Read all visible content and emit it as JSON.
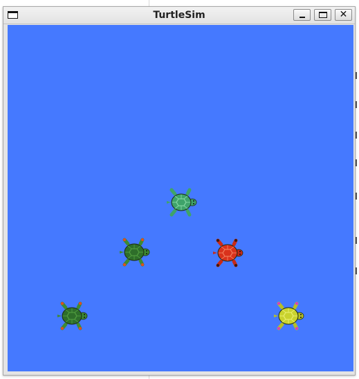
{
  "window": {
    "title": "TurtleSim"
  },
  "canvas": {
    "background_color": "#4579ff"
  },
  "turtles": [
    {
      "name": "turtle-top-center",
      "shell": "#3fa36a",
      "shell_pattern": "#7fd3a0",
      "limbs": "#3fa36a",
      "accent": "#3fa36a"
    },
    {
      "name": "turtle-middle-left",
      "shell": "#2e6e2a",
      "shell_pattern": "#4f9b3f",
      "limbs": "#3d8a34",
      "accent": "#e44b1f"
    },
    {
      "name": "turtle-middle-right",
      "shell": "#d9321c",
      "shell_pattern": "#f07a5a",
      "limbs": "#c72a18",
      "accent": "#3b1a10"
    },
    {
      "name": "turtle-bottom-left",
      "shell": "#2e6e2a",
      "shell_pattern": "#4f9b3f",
      "limbs": "#3d8a34",
      "accent": "#e44b1f"
    },
    {
      "name": "turtle-bottom-right",
      "shell": "#c9d22e",
      "shell_pattern": "#e6ec6a",
      "limbs": "#b6bf25",
      "accent": "#d63cc0"
    }
  ]
}
